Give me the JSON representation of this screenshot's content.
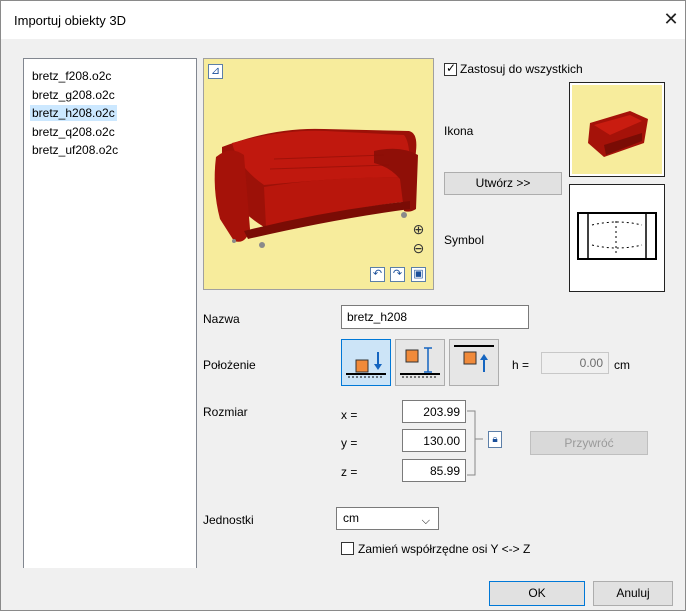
{
  "window": {
    "title": "Importuj obiekty 3D",
    "close_glyph": "✕"
  },
  "file_list": {
    "items": [
      {
        "label": "bretz_f208.o2c",
        "selected": false
      },
      {
        "label": "bretz_g208.o2c",
        "selected": false
      },
      {
        "label": "bretz_h208.o2c",
        "selected": true
      },
      {
        "label": "bretz_q208.o2c",
        "selected": false
      },
      {
        "label": "bretz_uf208.o2c",
        "selected": false
      }
    ]
  },
  "preview": {
    "background": "#f7ec9c",
    "tools": {
      "reset_view_icon": "reset-view-icon",
      "zoom_in_icon": "zoom-in-icon",
      "zoom_out_icon": "zoom-out-icon",
      "rotate_left_icon": "rotate-left-icon",
      "rotate_right_icon": "rotate-right-icon",
      "fit_icon": "fit-view-icon"
    }
  },
  "apply_all": {
    "label": "Zastosuj do wszystkich",
    "checked": true
  },
  "icon_section": {
    "label": "Ikona"
  },
  "create_button": {
    "label": "Utwórz >>"
  },
  "symbol_section": {
    "label": "Symbol"
  },
  "name": {
    "label": "Nazwa",
    "value": "bretz_h208"
  },
  "position": {
    "label": "Położenie",
    "h_label": "h =",
    "h_value": "0.00",
    "h_unit": "cm",
    "selected_index": 0
  },
  "size": {
    "label": "Rozmiar",
    "x_label": "x =",
    "x_value": "203.99",
    "y_label": "y =",
    "y_value": "130.00",
    "z_label": "z =",
    "z_value": "85.99",
    "restore_label": "Przywróć"
  },
  "units": {
    "label": "Jednostki",
    "value": "cm"
  },
  "swap_axes": {
    "label": "Zamień współrzędne osi Y <-> Z",
    "checked": false
  },
  "footer": {
    "ok_label": "OK",
    "cancel_label": "Anuluj"
  },
  "colors": {
    "accent": "#0078d7",
    "selection": "#cce8ff",
    "sofa": "#b8140c"
  }
}
